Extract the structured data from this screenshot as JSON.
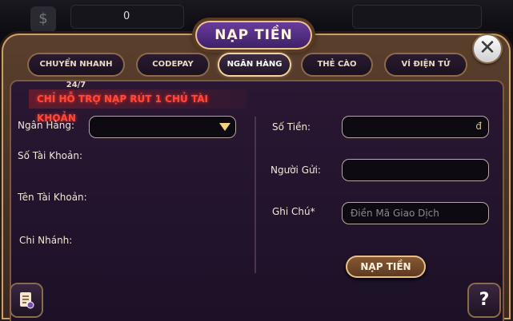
{
  "background": {
    "counter_value": "0"
  },
  "dialog": {
    "title": "NẠP TIỀN",
    "close_icon": "close-icon",
    "tabs": [
      {
        "label": "CHUYỂN NHANH 24/7"
      },
      {
        "label": "CODEPAY"
      },
      {
        "label": "NGÂN HÀNG",
        "active": true
      },
      {
        "label": "THẺ CÀO"
      },
      {
        "label": "VÍ ĐIỆN TỬ"
      }
    ],
    "notice": "CHỈ HỖ TRỢ NẠP RÚT 1 CHỦ TÀI KHOẢN",
    "left": {
      "bank_label": "Ngân Hàng:",
      "bank_value": "",
      "account_number_label": "Số Tài Khoản:",
      "account_name_label": "Tên Tài Khoản:",
      "branch_label": "Chi Nhánh:"
    },
    "right": {
      "amount_label": "Số Tiền:",
      "amount_unit": "đ",
      "sender_label": "Người Gửi:",
      "note_label": "Ghi Chú*",
      "note_placeholder": "Điền Mã Giao Dịch"
    },
    "submit_label": "NẠP TIỀN",
    "help_icon_text": "?"
  }
}
